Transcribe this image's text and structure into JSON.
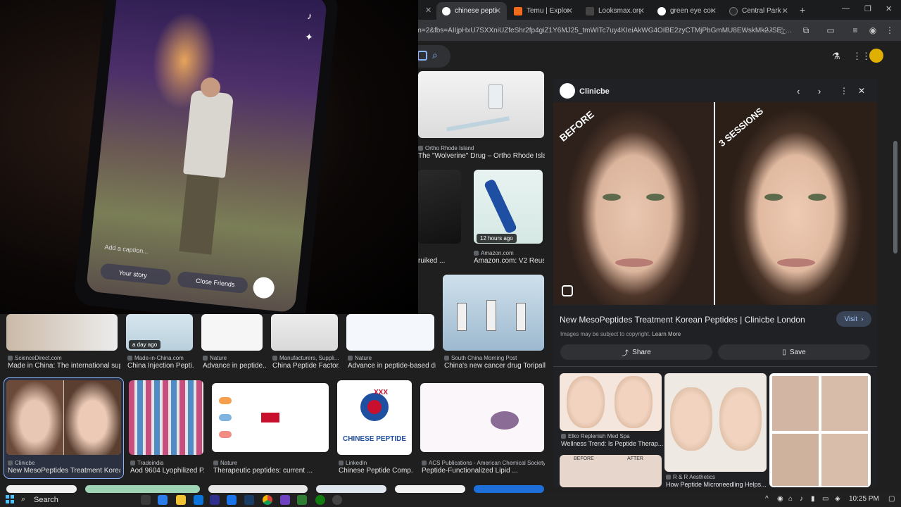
{
  "tabs": [
    {
      "title": "chinese peptid",
      "active": true,
      "icon": "google-icon"
    },
    {
      "title": "Temu | Explore",
      "active": false,
      "icon": "temu-icon"
    },
    {
      "title": "Looksmax.org",
      "active": false,
      "icon": "looksmax-icon"
    },
    {
      "title": "green eye cont",
      "active": false,
      "icon": "google-icon"
    },
    {
      "title": "Central Park – ",
      "active": false,
      "icon": "tab-icon"
    }
  ],
  "address": {
    "url": "dm=2&fbs=AIIjpHxU7SXXniUZfeShr2fp4giZ1Y6MJ25_tmWITc7uy4KIeiAkWG4OIBE2zyCTMjPbGmMU8EWskMk2JSE_..."
  },
  "results": {
    "row1": [
      {
        "source": "Ortho Rhode Island",
        "caption": "The \"Wolverine\" Drug – Ortho Rhode Island"
      }
    ],
    "row2": [
      {
        "source": "",
        "caption": "ruiked ..."
      },
      {
        "source": "Amazon.com",
        "caption": "Amazon.com: V2 Reus...",
        "badge": "12 hours ago"
      }
    ],
    "row3": [
      {
        "source": "ScienceDirect.com",
        "caption": "Made in China: The international sup..."
      },
      {
        "source": "Made-in-China.com",
        "caption": "China Injection Pepti...",
        "badge": "a day ago"
      },
      {
        "source": "Nature",
        "caption": "Advance in peptide..."
      },
      {
        "source": "Manufacturers, Suppli...",
        "caption": "China Peptide Factor..."
      },
      {
        "source": "Nature",
        "caption": "Advance in peptide-based dr..."
      },
      {
        "source": "South China Morning Post",
        "caption": "China's new cancer drug Toripall..."
      }
    ],
    "row4": [
      {
        "source": "Clinicbe",
        "caption": "New MesoPeptides Treatment Korean ..."
      },
      {
        "source": "Tradeindia",
        "caption": "Aod 9604 Lyophilized P..."
      },
      {
        "source": "Nature",
        "caption": "Therapeutic peptides: current ..."
      },
      {
        "source": "LinkedIn",
        "caption": "Chinese Peptide Comp...",
        "logo_text": "CHINESE PEPTIDE",
        "logo_mark": "XXX"
      },
      {
        "source": "ACS Publications - American Chemical Society",
        "caption": "Peptide-Functionalized Lipid ..."
      }
    ]
  },
  "panel": {
    "site": "Clinicbe",
    "before_label": "BEFORE",
    "after_label": "3 SESSIONS",
    "title": "New MesoPeptides Treatment Korean Peptides | Clinicbe London",
    "visit_label": "Visit",
    "copyright": "Images may be subject to copyright.",
    "learn_more": "Learn More",
    "share_label": "Share",
    "save_label": "Save",
    "related": [
      {
        "source": "Elko Replenish Med Spa",
        "caption": "Wellness Trend: Is Peptide Therap..."
      },
      {
        "source": "R & R Aesthetics",
        "caption": "How Peptide Microneedling Helps..."
      },
      {
        "source": "",
        "caption": ""
      }
    ],
    "related_labels": {
      "before": "BEFORE",
      "after": "AFTER"
    }
  },
  "overlay": {
    "caption_left": "Your story",
    "caption_right": "Close Friends",
    "small_text": "Add a caption..."
  },
  "taskbar": {
    "search_label": "Search",
    "time": "10:25 PM"
  },
  "colors": {
    "accent": "#8ab4f8",
    "visit_bg": "#394457",
    "panel_bg": "#202124",
    "page_bg": "#1f1f1f"
  }
}
